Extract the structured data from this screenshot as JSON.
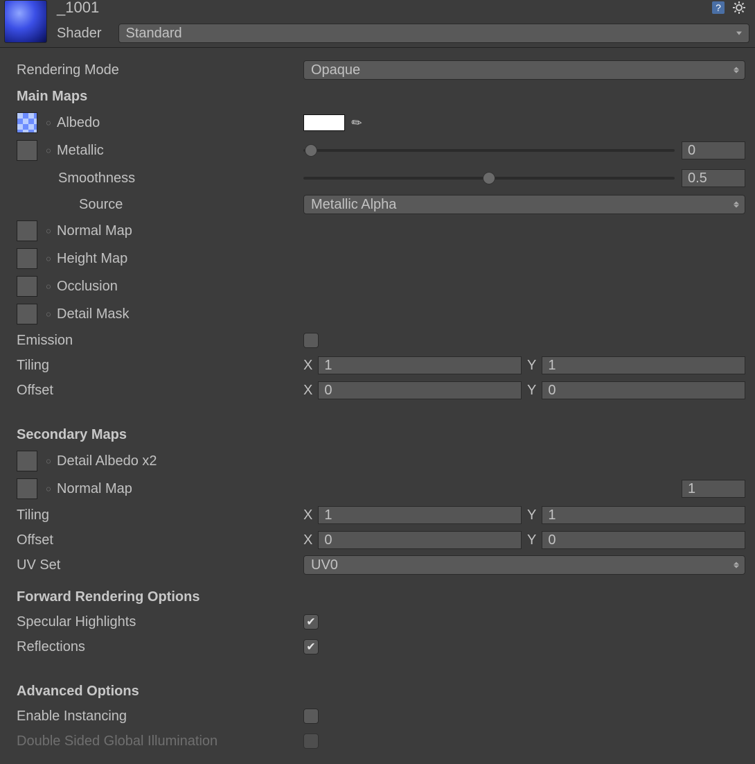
{
  "header": {
    "material_name": "_1001",
    "shader_label": "Shader",
    "shader_value": "Standard"
  },
  "rendering_mode": {
    "label": "Rendering Mode",
    "value": "Opaque"
  },
  "main_maps": {
    "title": "Main Maps",
    "albedo": {
      "label": "Albedo"
    },
    "metallic": {
      "label": "Metallic",
      "value": "0"
    },
    "smoothness": {
      "label": "Smoothness",
      "value": "0.5"
    },
    "source": {
      "label": "Source",
      "value": "Metallic Alpha"
    },
    "normal_map": {
      "label": "Normal Map"
    },
    "height_map": {
      "label": "Height Map"
    },
    "occlusion": {
      "label": "Occlusion"
    },
    "detail_mask": {
      "label": "Detail Mask"
    },
    "emission": {
      "label": "Emission"
    },
    "tiling": {
      "label": "Tiling",
      "x": "1",
      "y": "1"
    },
    "offset": {
      "label": "Offset",
      "x": "0",
      "y": "0"
    }
  },
  "secondary_maps": {
    "title": "Secondary Maps",
    "detail_albedo": {
      "label": "Detail Albedo x2"
    },
    "normal_map": {
      "label": "Normal Map",
      "value": "1"
    },
    "tiling": {
      "label": "Tiling",
      "x": "1",
      "y": "1"
    },
    "offset": {
      "label": "Offset",
      "x": "0",
      "y": "0"
    },
    "uv_set": {
      "label": "UV Set",
      "value": "UV0"
    }
  },
  "forward": {
    "title": "Forward Rendering Options",
    "specular": {
      "label": "Specular Highlights"
    },
    "reflections": {
      "label": "Reflections"
    }
  },
  "advanced": {
    "title": "Advanced Options",
    "instancing": {
      "label": "Enable Instancing"
    },
    "double_sided": {
      "label": "Double Sided Global Illumination"
    }
  },
  "xy": {
    "x": "X",
    "y": "Y"
  }
}
